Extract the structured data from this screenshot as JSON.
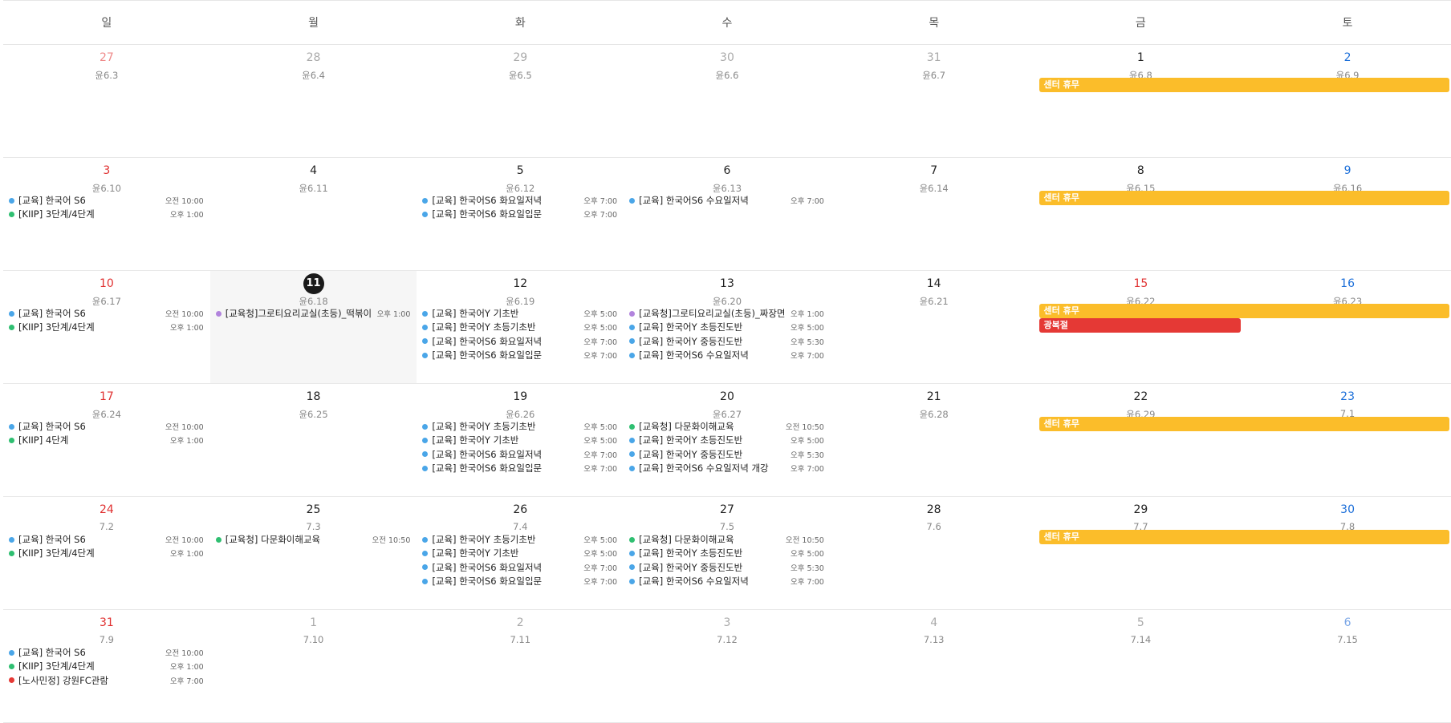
{
  "colors": {
    "blue": "#4aa6e8",
    "green": "#2fbf71",
    "purple": "#b284dd",
    "red": "#e53935",
    "holiday_orange": "#fbbd2a",
    "holiday_red": "#e53935"
  },
  "weekdays": [
    "일",
    "월",
    "화",
    "수",
    "목",
    "금",
    "토"
  ],
  "weeks": [
    {
      "days": [
        {
          "day": "27",
          "lunar": "윤6.3",
          "other": true,
          "events": []
        },
        {
          "day": "28",
          "lunar": "윤6.4",
          "other": true,
          "events": []
        },
        {
          "day": "29",
          "lunar": "윤6.5",
          "other": true,
          "events": []
        },
        {
          "day": "30",
          "lunar": "윤6.6",
          "other": true,
          "events": []
        },
        {
          "day": "31",
          "lunar": "윤6.7",
          "other": true,
          "events": []
        },
        {
          "day": "1",
          "lunar": "윤6.8",
          "other": false,
          "events": []
        },
        {
          "day": "2",
          "lunar": "윤6.9",
          "other": false,
          "events": []
        }
      ],
      "banners": [
        {
          "label": "센터 휴무",
          "start": 5,
          "span": 2,
          "lane": 0,
          "color": "holiday_orange"
        }
      ]
    },
    {
      "days": [
        {
          "day": "3",
          "lunar": "윤6.10",
          "other": false,
          "events": [
            {
              "title": "[교육] 한국어 S6",
              "time": "오전 10:00",
              "color": "blue"
            },
            {
              "title": "[KIIP] 3단계/4단계",
              "time": "오후 1:00",
              "color": "green"
            }
          ]
        },
        {
          "day": "4",
          "lunar": "윤6.11",
          "other": false,
          "events": []
        },
        {
          "day": "5",
          "lunar": "윤6.12",
          "other": false,
          "events": [
            {
              "title": "[교육] 한국어S6 화요일저녁",
              "time": "오후 7:00",
              "color": "blue"
            },
            {
              "title": "[교육] 한국어S6 화요일입문",
              "time": "오후 7:00",
              "color": "blue"
            }
          ]
        },
        {
          "day": "6",
          "lunar": "윤6.13",
          "other": false,
          "events": [
            {
              "title": "[교육] 한국어S6 수요일저녁",
              "time": "오후 7:00",
              "color": "blue"
            }
          ]
        },
        {
          "day": "7",
          "lunar": "윤6.14",
          "other": false,
          "events": []
        },
        {
          "day": "8",
          "lunar": "윤6.15",
          "other": false,
          "events": []
        },
        {
          "day": "9",
          "lunar": "윤6.16",
          "other": false,
          "events": []
        }
      ],
      "banners": [
        {
          "label": "센터 휴무",
          "start": 5,
          "span": 2,
          "lane": 0,
          "color": "holiday_orange"
        }
      ]
    },
    {
      "days": [
        {
          "day": "10",
          "lunar": "윤6.17",
          "other": false,
          "events": [
            {
              "title": "[교육] 한국어 S6",
              "time": "오전 10:00",
              "color": "blue"
            },
            {
              "title": "[KIIP] 3단계/4단계",
              "time": "오후 1:00",
              "color": "green"
            }
          ]
        },
        {
          "day": "11",
          "lunar": "윤6.18",
          "other": false,
          "today": true,
          "events": [
            {
              "title": "[교육청]그로티요리교실(초등)_떡볶이",
              "time": "오후 1:00",
              "color": "purple"
            }
          ]
        },
        {
          "day": "12",
          "lunar": "윤6.19",
          "other": false,
          "events": [
            {
              "title": "[교육] 한국어Y 기초반",
              "time": "오후 5:00",
              "color": "blue"
            },
            {
              "title": "[교육] 한국어Y 초등기초반",
              "time": "오후 5:00",
              "color": "blue"
            },
            {
              "title": "[교육] 한국어S6 화요일저녁",
              "time": "오후 7:00",
              "color": "blue"
            },
            {
              "title": "[교육] 한국어S6 화요일입문",
              "time": "오후 7:00",
              "color": "blue"
            }
          ]
        },
        {
          "day": "13",
          "lunar": "윤6.20",
          "other": false,
          "events": [
            {
              "title": "[교육청]그로티요리교실(초등)_짜장면",
              "time": "오후 1:00",
              "color": "purple"
            },
            {
              "title": "[교육] 한국어Y 초등진도반",
              "time": "오후 5:00",
              "color": "blue"
            },
            {
              "title": "[교육] 한국어Y 중등진도반",
              "time": "오후 5:30",
              "color": "blue"
            },
            {
              "title": "[교육] 한국어S6 수요일저녁",
              "time": "오후 7:00",
              "color": "blue"
            }
          ]
        },
        {
          "day": "14",
          "lunar": "윤6.21",
          "other": false,
          "events": []
        },
        {
          "day": "15",
          "lunar": "윤6.22",
          "other": false,
          "sunday_style": true,
          "events": []
        },
        {
          "day": "16",
          "lunar": "윤6.23",
          "other": false,
          "events": []
        }
      ],
      "banners": [
        {
          "label": "센터 휴무",
          "start": 5,
          "span": 2,
          "lane": 0,
          "color": "holiday_orange"
        },
        {
          "label": "광복절",
          "start": 5,
          "span": 1,
          "lane": 1,
          "color": "holiday_red"
        }
      ]
    },
    {
      "days": [
        {
          "day": "17",
          "lunar": "윤6.24",
          "other": false,
          "events": [
            {
              "title": "[교육] 한국어 S6",
              "time": "오전 10:00",
              "color": "blue"
            },
            {
              "title": "[KIIP] 4단계",
              "time": "오후 1:00",
              "color": "green"
            }
          ]
        },
        {
          "day": "18",
          "lunar": "윤6.25",
          "other": false,
          "events": []
        },
        {
          "day": "19",
          "lunar": "윤6.26",
          "other": false,
          "events": [
            {
              "title": "[교육] 한국어Y 초등기초반",
              "time": "오후 5:00",
              "color": "blue"
            },
            {
              "title": "[교육] 한국어Y 기초반",
              "time": "오후 5:00",
              "color": "blue"
            },
            {
              "title": "[교육] 한국어S6 화요일저녁",
              "time": "오후 7:00",
              "color": "blue"
            },
            {
              "title": "[교육] 한국어S6 화요일입문",
              "time": "오후 7:00",
              "color": "blue"
            }
          ]
        },
        {
          "day": "20",
          "lunar": "윤6.27",
          "other": false,
          "events": [
            {
              "title": "[교육청] 다문화이해교육",
              "time": "오전 10:50",
              "color": "green"
            },
            {
              "title": "[교육] 한국어Y 초등진도반",
              "time": "오후 5:00",
              "color": "blue"
            },
            {
              "title": "[교육] 한국어Y 중등진도반",
              "time": "오후 5:30",
              "color": "blue"
            },
            {
              "title": "[교육] 한국어S6 수요일저녁 개강",
              "time": "오후 7:00",
              "color": "blue"
            }
          ]
        },
        {
          "day": "21",
          "lunar": "윤6.28",
          "other": false,
          "events": []
        },
        {
          "day": "22",
          "lunar": "윤6.29",
          "other": false,
          "events": []
        },
        {
          "day": "23",
          "lunar": "7.1",
          "other": false,
          "events": []
        }
      ],
      "banners": [
        {
          "label": "센터 휴무",
          "start": 5,
          "span": 2,
          "lane": 0,
          "color": "holiday_orange"
        }
      ]
    },
    {
      "days": [
        {
          "day": "24",
          "lunar": "7.2",
          "other": false,
          "events": [
            {
              "title": "[교육] 한국어 S6",
              "time": "오전 10:00",
              "color": "blue"
            },
            {
              "title": "[KIIP] 3단계/4단계",
              "time": "오후 1:00",
              "color": "green"
            }
          ]
        },
        {
          "day": "25",
          "lunar": "7.3",
          "other": false,
          "events": [
            {
              "title": "[교육청] 다문화이해교육",
              "time": "오전 10:50",
              "color": "green"
            }
          ]
        },
        {
          "day": "26",
          "lunar": "7.4",
          "other": false,
          "events": [
            {
              "title": "[교육] 한국어Y 초등기초반",
              "time": "오후 5:00",
              "color": "blue"
            },
            {
              "title": "[교육] 한국어Y 기초반",
              "time": "오후 5:00",
              "color": "blue"
            },
            {
              "title": "[교육] 한국어S6 화요일저녁",
              "time": "오후 7:00",
              "color": "blue"
            },
            {
              "title": "[교육] 한국어S6 화요일입문",
              "time": "오후 7:00",
              "color": "blue"
            }
          ]
        },
        {
          "day": "27",
          "lunar": "7.5",
          "other": false,
          "events": [
            {
              "title": "[교육청] 다문화이해교육",
              "time": "오전 10:50",
              "color": "green"
            },
            {
              "title": "[교육] 한국어Y 초등진도반",
              "time": "오후 5:00",
              "color": "blue"
            },
            {
              "title": "[교육] 한국어Y 중등진도반",
              "time": "오후 5:30",
              "color": "blue"
            },
            {
              "title": "[교육] 한국어S6 수요일저녁",
              "time": "오후 7:00",
              "color": "blue"
            }
          ]
        },
        {
          "day": "28",
          "lunar": "7.6",
          "other": false,
          "events": []
        },
        {
          "day": "29",
          "lunar": "7.7",
          "other": false,
          "events": []
        },
        {
          "day": "30",
          "lunar": "7.8",
          "other": false,
          "events": []
        }
      ],
      "banners": [
        {
          "label": "센터 휴무",
          "start": 5,
          "span": 2,
          "lane": 0,
          "color": "holiday_orange"
        }
      ]
    },
    {
      "days": [
        {
          "day": "31",
          "lunar": "7.9",
          "other": false,
          "events": [
            {
              "title": "[교육] 한국어 S6",
              "time": "오전 10:00",
              "color": "blue"
            },
            {
              "title": "[KIIP] 3단계/4단계",
              "time": "오후 1:00",
              "color": "green"
            },
            {
              "title": "[노사민정] 강원FC관람",
              "time": "오후 7:00",
              "color": "red"
            }
          ]
        },
        {
          "day": "1",
          "lunar": "7.10",
          "other": true,
          "events": []
        },
        {
          "day": "2",
          "lunar": "7.11",
          "other": true,
          "events": []
        },
        {
          "day": "3",
          "lunar": "7.12",
          "other": true,
          "events": []
        },
        {
          "day": "4",
          "lunar": "7.13",
          "other": true,
          "events": []
        },
        {
          "day": "5",
          "lunar": "7.14",
          "other": true,
          "events": []
        },
        {
          "day": "6",
          "lunar": "7.15",
          "other": true,
          "events": []
        }
      ],
      "banners": []
    }
  ]
}
